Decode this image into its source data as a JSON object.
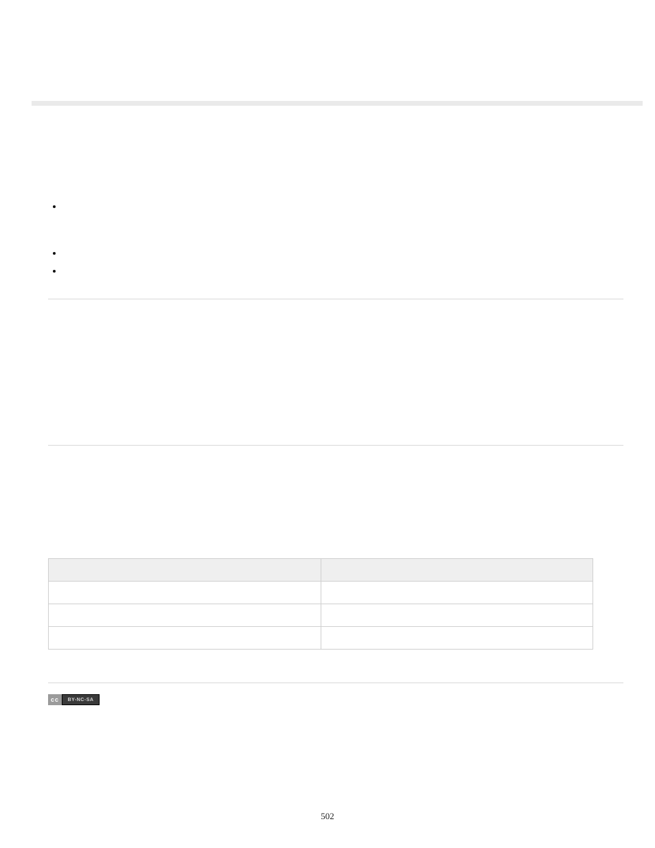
{
  "bullets": [
    {
      "text": ""
    },
    {
      "text": ""
    },
    {
      "text": ""
    }
  ],
  "table": {
    "headers": [
      "",
      ""
    ],
    "rows": [
      [
        "",
        ""
      ],
      [
        "",
        ""
      ],
      [
        "",
        ""
      ]
    ]
  },
  "license": {
    "cc_prefix": "cc",
    "cc_suffix": "BY-NC-SA"
  },
  "page_number": "502"
}
